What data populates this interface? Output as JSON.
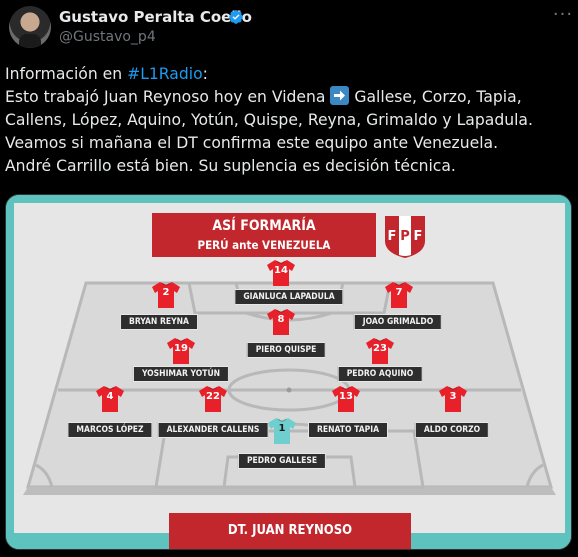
{
  "author": {
    "display_name": "Gustavo Peralta Coello",
    "handle": "@Gustavo_p4",
    "verified": true,
    "avatar_icon": "user-avatar"
  },
  "more_label": "···",
  "tweet": {
    "line1_prefix": "Información en ",
    "hashtag": "#L1Radio",
    "line1_suffix": ":",
    "line2_before_arrow": "Esto trabajó Juan Reynoso hoy en Videna",
    "line2_after_arrow": " Gallese, Corzo, Tapia,",
    "line3": "Callens, López, Aquino, Yotún, Quispe, Reyna, Grimaldo y Lapadula.",
    "line4": "Veamos si mañana el DT confirma este equipo ante Venezuela.",
    "line5": "André Carrillo está bien. Su suplencia es decisión técnica."
  },
  "graphic": {
    "title": "ASÍ FORMARÍA",
    "subtitle": "PERÚ ante VENEZUELA",
    "federation_letters": [
      "F",
      "P",
      "F"
    ],
    "coach": "DT. JUAN REYNOSO",
    "colors": {
      "jersey": "#e8202a",
      "gk_jersey": "#6fcfcf",
      "accent": "#c1272d",
      "background": "#5ec3be"
    },
    "players": [
      {
        "number": "14",
        "name": "GIANLUCA LAPADULA"
      },
      {
        "number": "2",
        "name": "BRYAN REYNA"
      },
      {
        "number": "7",
        "name": "JOAO GRIMALDO"
      },
      {
        "number": "8",
        "name": "PIERO QUISPE"
      },
      {
        "number": "19",
        "name": "YOSHIMAR YOTÚN"
      },
      {
        "number": "23",
        "name": "PEDRO AQUINO"
      },
      {
        "number": "4",
        "name": "MARCOS LÓPEZ"
      },
      {
        "number": "22",
        "name": "ALEXANDER CALLENS"
      },
      {
        "number": "13",
        "name": "RENATO TAPIA"
      },
      {
        "number": "3",
        "name": "ALDO CORZO"
      },
      {
        "number": "1",
        "name": "PEDRO GALLESE"
      }
    ]
  }
}
